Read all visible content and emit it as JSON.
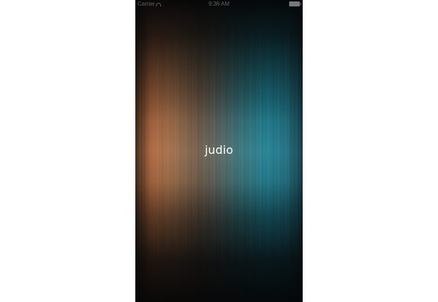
{
  "status_bar": {
    "carrier": "Carrier",
    "time": "9:36 AM",
    "wifi_icon": "wifi-icon",
    "battery_icon": "battery-icon"
  },
  "splash": {
    "title": "judio"
  },
  "colors": {
    "warm_accent": "#b0673c",
    "cool_accent": "#1a7e92",
    "background_dark": "#07090a",
    "title_text": "#ffffff"
  }
}
